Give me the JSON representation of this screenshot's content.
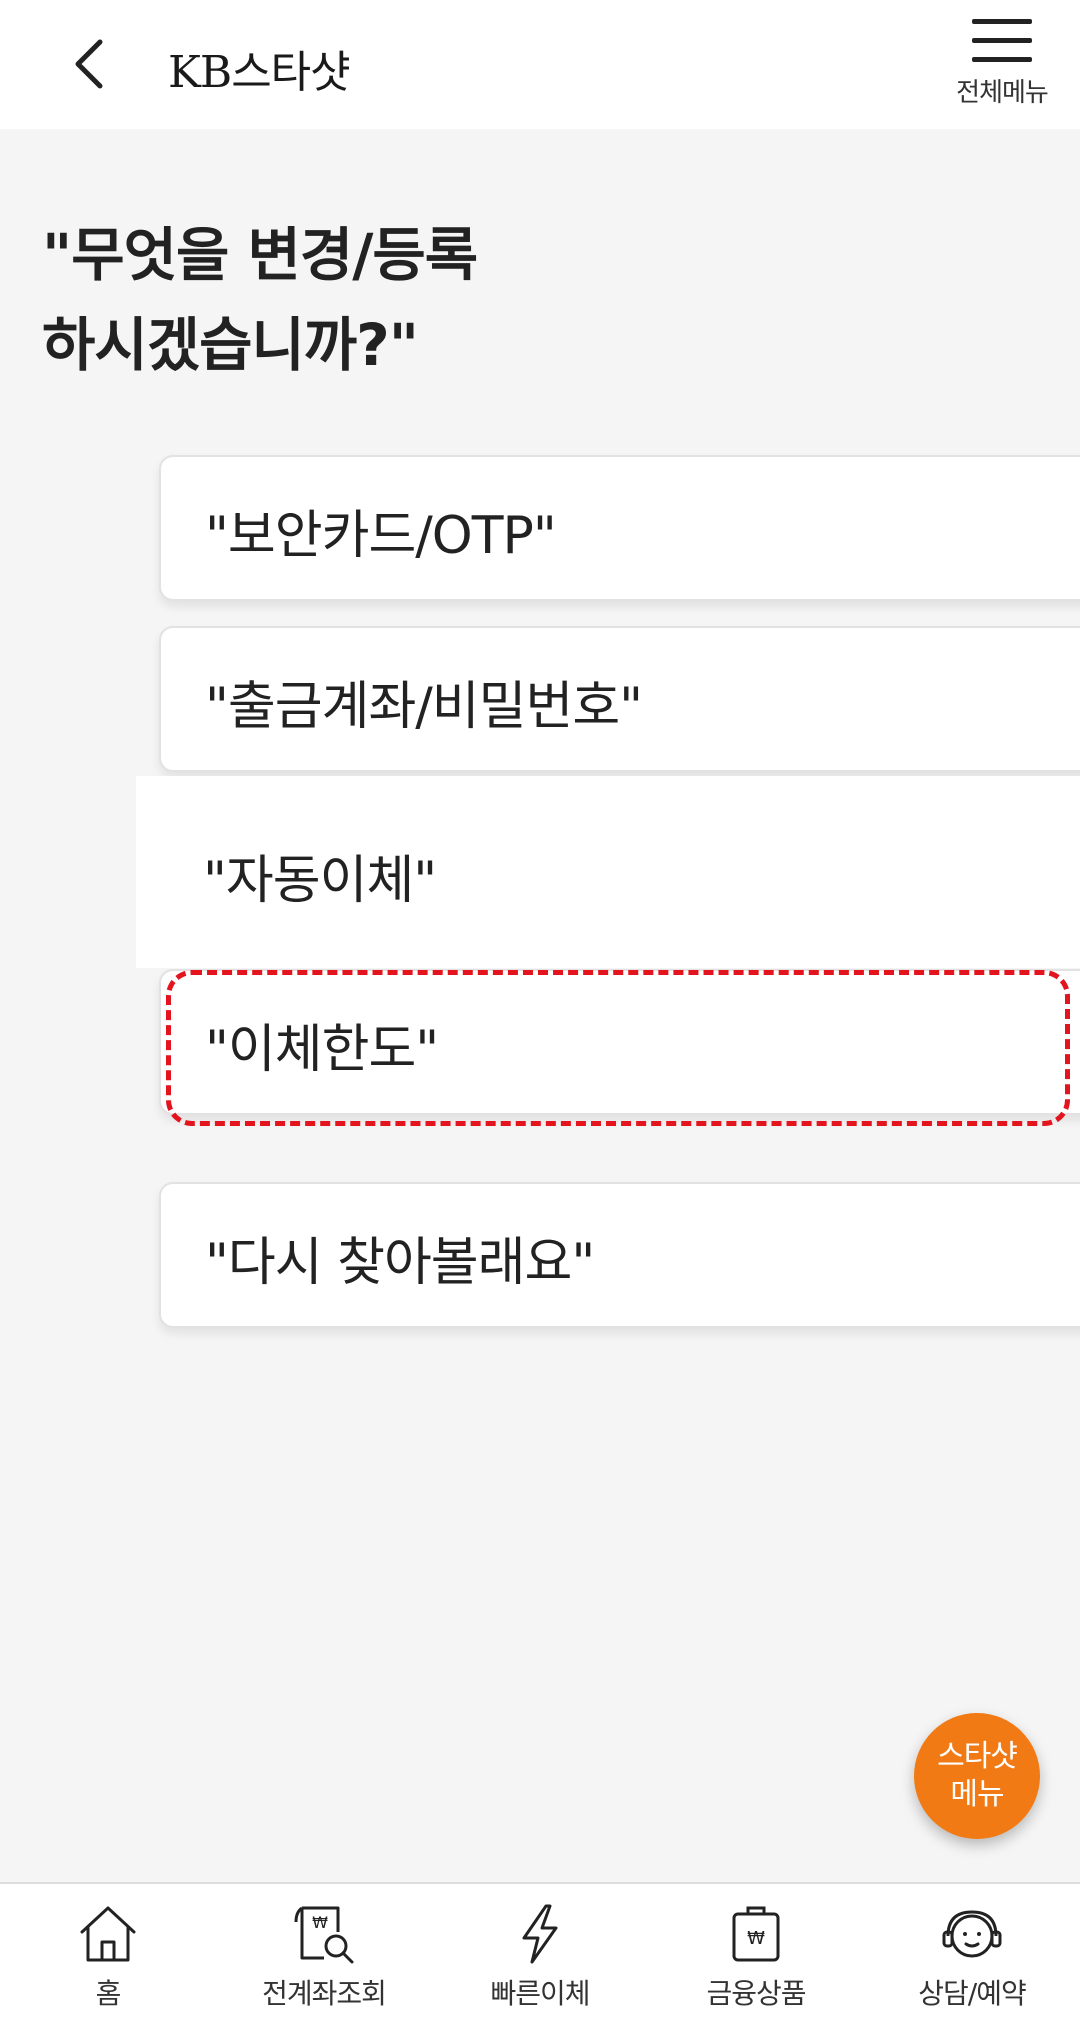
{
  "header": {
    "title": "KB스타샷",
    "menu_label": "전체메뉴",
    "back_icon": "chevron-left-icon",
    "menu_icon": "hamburger-icon"
  },
  "question": "\"무엇을 변경/등록\n하시겠습니까?\"",
  "options": [
    {
      "label": "\"보안카드/OTP\""
    },
    {
      "label": "\"출금계좌/비밀번호\""
    },
    {
      "label": "\"자동이체\""
    },
    {
      "label": "\"이체한도\""
    },
    {
      "label": "\"다시 찾아볼래요\""
    }
  ],
  "fab": {
    "line1": "스타샷",
    "line2": "메뉴",
    "color": "#f27a14"
  },
  "tabbar": {
    "items": [
      {
        "label": "홈",
        "icon": "home-icon"
      },
      {
        "label": "전계좌조회",
        "icon": "account-search-icon"
      },
      {
        "label": "빠른이체",
        "icon": "lightning-icon"
      },
      {
        "label": "금융상품",
        "icon": "finance-bag-icon"
      },
      {
        "label": "상담/예약",
        "icon": "headset-agent-icon"
      }
    ]
  },
  "colors": {
    "highlight": "#e3141e",
    "background": "#f5f5f5"
  }
}
